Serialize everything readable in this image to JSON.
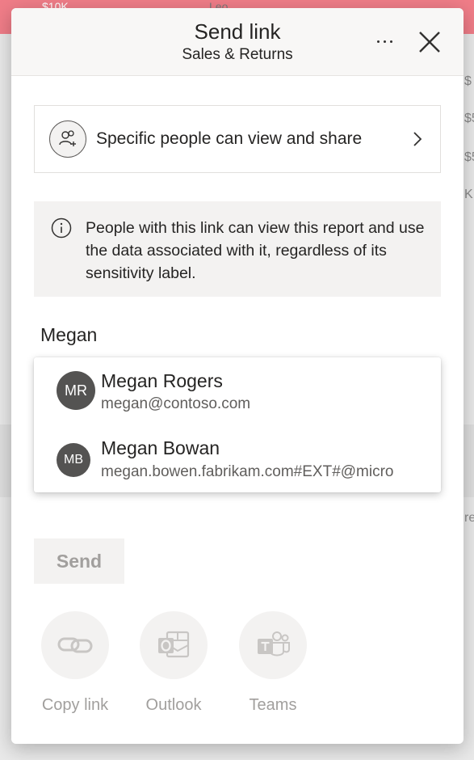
{
  "background": {
    "chip_left": "$10K",
    "chip_right": "Leo",
    "right_edge_chars": [
      "$",
      "$5",
      "$5",
      "K",
      "re"
    ]
  },
  "dialog": {
    "title": "Send link",
    "subtitle": "Sales & Returns",
    "more_icon": "ellipsis-icon",
    "close_icon": "close-icon"
  },
  "permission": {
    "label": "Specific people can view and share",
    "icon": "people-icon",
    "chevron_icon": "chevron-right-icon"
  },
  "info": {
    "icon": "info-icon",
    "text": "People with this link can view this report and use the data associated with it, regardless of its sensitivity label."
  },
  "people_input": {
    "value": "Megan"
  },
  "suggestions": [
    {
      "initials": "MR",
      "name": "Megan Rogers",
      "email": "megan@contoso.com"
    },
    {
      "initials": "MB",
      "name": "Megan Bowan",
      "email": "megan.bowen.fabrikam.com#EXT#@micro"
    }
  ],
  "actions": {
    "send_label": "Send"
  },
  "share_options": [
    {
      "label": "Copy link",
      "icon": "link-icon"
    },
    {
      "label": "Outlook",
      "icon": "outlook-icon"
    },
    {
      "label": "Teams",
      "icon": "teams-icon"
    }
  ],
  "colors": {
    "accent_disabled": "#a19f9d",
    "avatar_bg": "#545352",
    "header_bg": "#f8f7f6",
    "info_bg": "#f3f2f1",
    "background_pink": "#f07d88"
  }
}
